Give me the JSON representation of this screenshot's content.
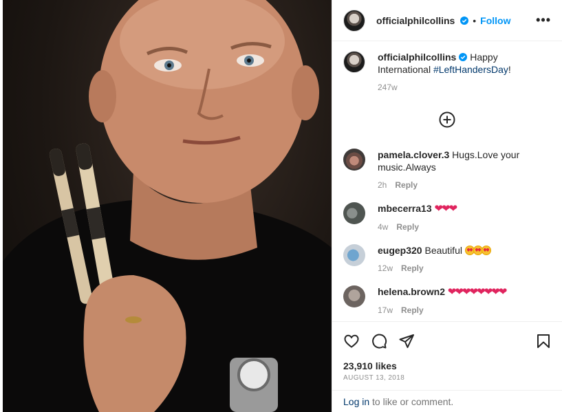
{
  "post": {
    "username": "officialphilcollins",
    "follow_label": "Follow",
    "dot": "•",
    "more_label": "•••",
    "caption_text": " Happy International ",
    "caption_hashtag": "#LeftHandersDay",
    "caption_end": "!",
    "caption_age": "247w",
    "likes": "23,910 likes",
    "date": "AUGUST 13, 2018"
  },
  "comments": [
    {
      "user": "pamela.clover.3",
      "text": " Hugs.Love your music.Always",
      "age": "2h",
      "reply": "Reply"
    },
    {
      "user": "mbecerra13",
      "text": " ",
      "emoji": "❤❤❤",
      "age": "4w",
      "reply": "Reply"
    },
    {
      "user": "eugep320",
      "text": " Beautiful ",
      "age": "12w",
      "reply": "Reply"
    },
    {
      "user": "helena.brown2",
      "text": " ",
      "emoji": "❤❤❤❤❤❤❤❤",
      "age": "17w",
      "reply": "Reply"
    }
  ],
  "footer": {
    "login_link": "Log in",
    "login_rest": " to like or comment."
  },
  "colors": {
    "accent": "#0095f6",
    "hashtag": "#00376b",
    "muted": "#8e8e8e"
  },
  "icons": [
    "verified-badge-icon",
    "more-options-icon",
    "load-more-plus-icon",
    "heart-icon",
    "comment-icon",
    "share-icon",
    "bookmark-icon"
  ]
}
